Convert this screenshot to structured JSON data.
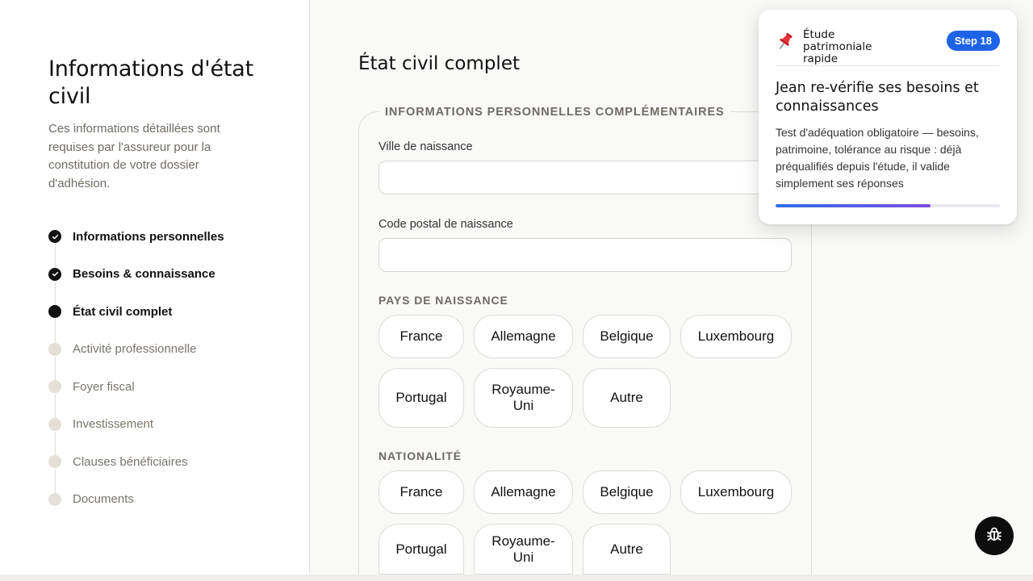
{
  "sidebar": {
    "title": "Informations d'état civil",
    "description": "Ces informations détaillées sont requises par l'assureur pour la constitution de votre dossier d'adhésion.",
    "steps": [
      {
        "label": "Informations personnelles",
        "state": "done"
      },
      {
        "label": "Besoins & connaissance",
        "state": "done"
      },
      {
        "label": "État civil complet",
        "state": "current"
      },
      {
        "label": "Activité professionnelle",
        "state": "pending"
      },
      {
        "label": "Foyer fiscal",
        "state": "pending"
      },
      {
        "label": "Investissement",
        "state": "pending"
      },
      {
        "label": "Clauses bénéficiaires",
        "state": "pending"
      },
      {
        "label": "Documents",
        "state": "pending"
      }
    ]
  },
  "main": {
    "title": "État civil complet",
    "section_title": "INFORMATIONS PERSONNELLES COMPLÉMENTAIRES",
    "birth_city": {
      "label": "Ville de naissance",
      "value": ""
    },
    "birth_postcode": {
      "label": "Code postal de naissance",
      "value": ""
    },
    "birth_country": {
      "label": "PAYS DE NAISSANCE",
      "options": [
        "France",
        "Allemagne",
        "Belgique",
        "Luxembourg",
        "Portugal",
        "Royaume-Uni",
        "Autre"
      ]
    },
    "nationality": {
      "label": "NATIONALITÉ",
      "options": [
        "France",
        "Allemagne",
        "Belgique",
        "Luxembourg",
        "Portugal",
        "Royaume-Uni",
        "Autre"
      ]
    }
  },
  "tour": {
    "icon": "pushpin-icon",
    "name": "Étude patrimoniale rapide",
    "badge": "Step 18",
    "heading": "Jean re-vérifie ses besoins et connaissances",
    "body": "Test d'adéquation obligatoire — besoins, patrimoine, tolérance au risque : déjà préqualifiés depuis l'étude, il valide simplement ses réponses",
    "progress": 0.69
  },
  "colors": {
    "accent": "#1d63e8",
    "progress_end": "#7c4ddf",
    "done_dot": "#111111",
    "pending_dot": "#e4e0d8"
  },
  "debug_button": {
    "icon": "bug-icon"
  }
}
